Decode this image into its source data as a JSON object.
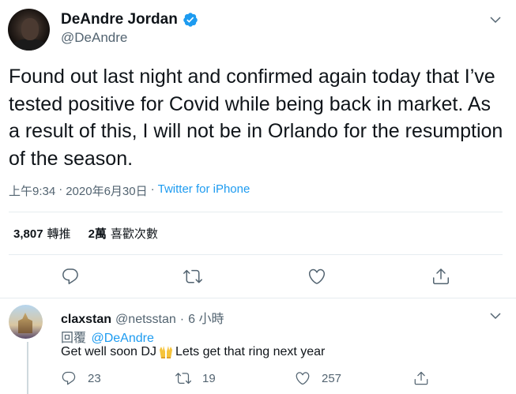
{
  "tweet": {
    "display_name": "DeAndre Jordan",
    "handle": "@DeAndre",
    "text": "Found out last night and confirmed again today that I’ve tested positive for Covid while being back in market. As a result of this, I will not be in Orlando for the resumption of the season.",
    "time": "上午9:34",
    "date": "2020年6月30日",
    "separator": "·",
    "source": "Twitter for iPhone",
    "retweets_count": "3,807",
    "retweets_label": "轉推",
    "likes_count": "2萬",
    "likes_label": "喜歡次數"
  },
  "reply": {
    "display_name": "claxstan",
    "handle": "@netsstan",
    "dot": "·",
    "time": "6 小時",
    "reply_to_label": "回覆",
    "reply_to_mention": "@DeAndre",
    "text_before": "Get well soon DJ",
    "text_after": "Lets get that ring next year",
    "reply_count": "23",
    "retweet_count": "19",
    "like_count": "257"
  },
  "icons": {
    "verified": "verified-badge-icon",
    "caret": "chevron-down-icon",
    "reply": "reply-icon",
    "retweet": "retweet-icon",
    "like": "heart-icon",
    "share": "share-icon"
  },
  "colors": {
    "accent": "#1d9bf0",
    "secondary_text": "#536471",
    "divider": "#e6ecf0"
  }
}
